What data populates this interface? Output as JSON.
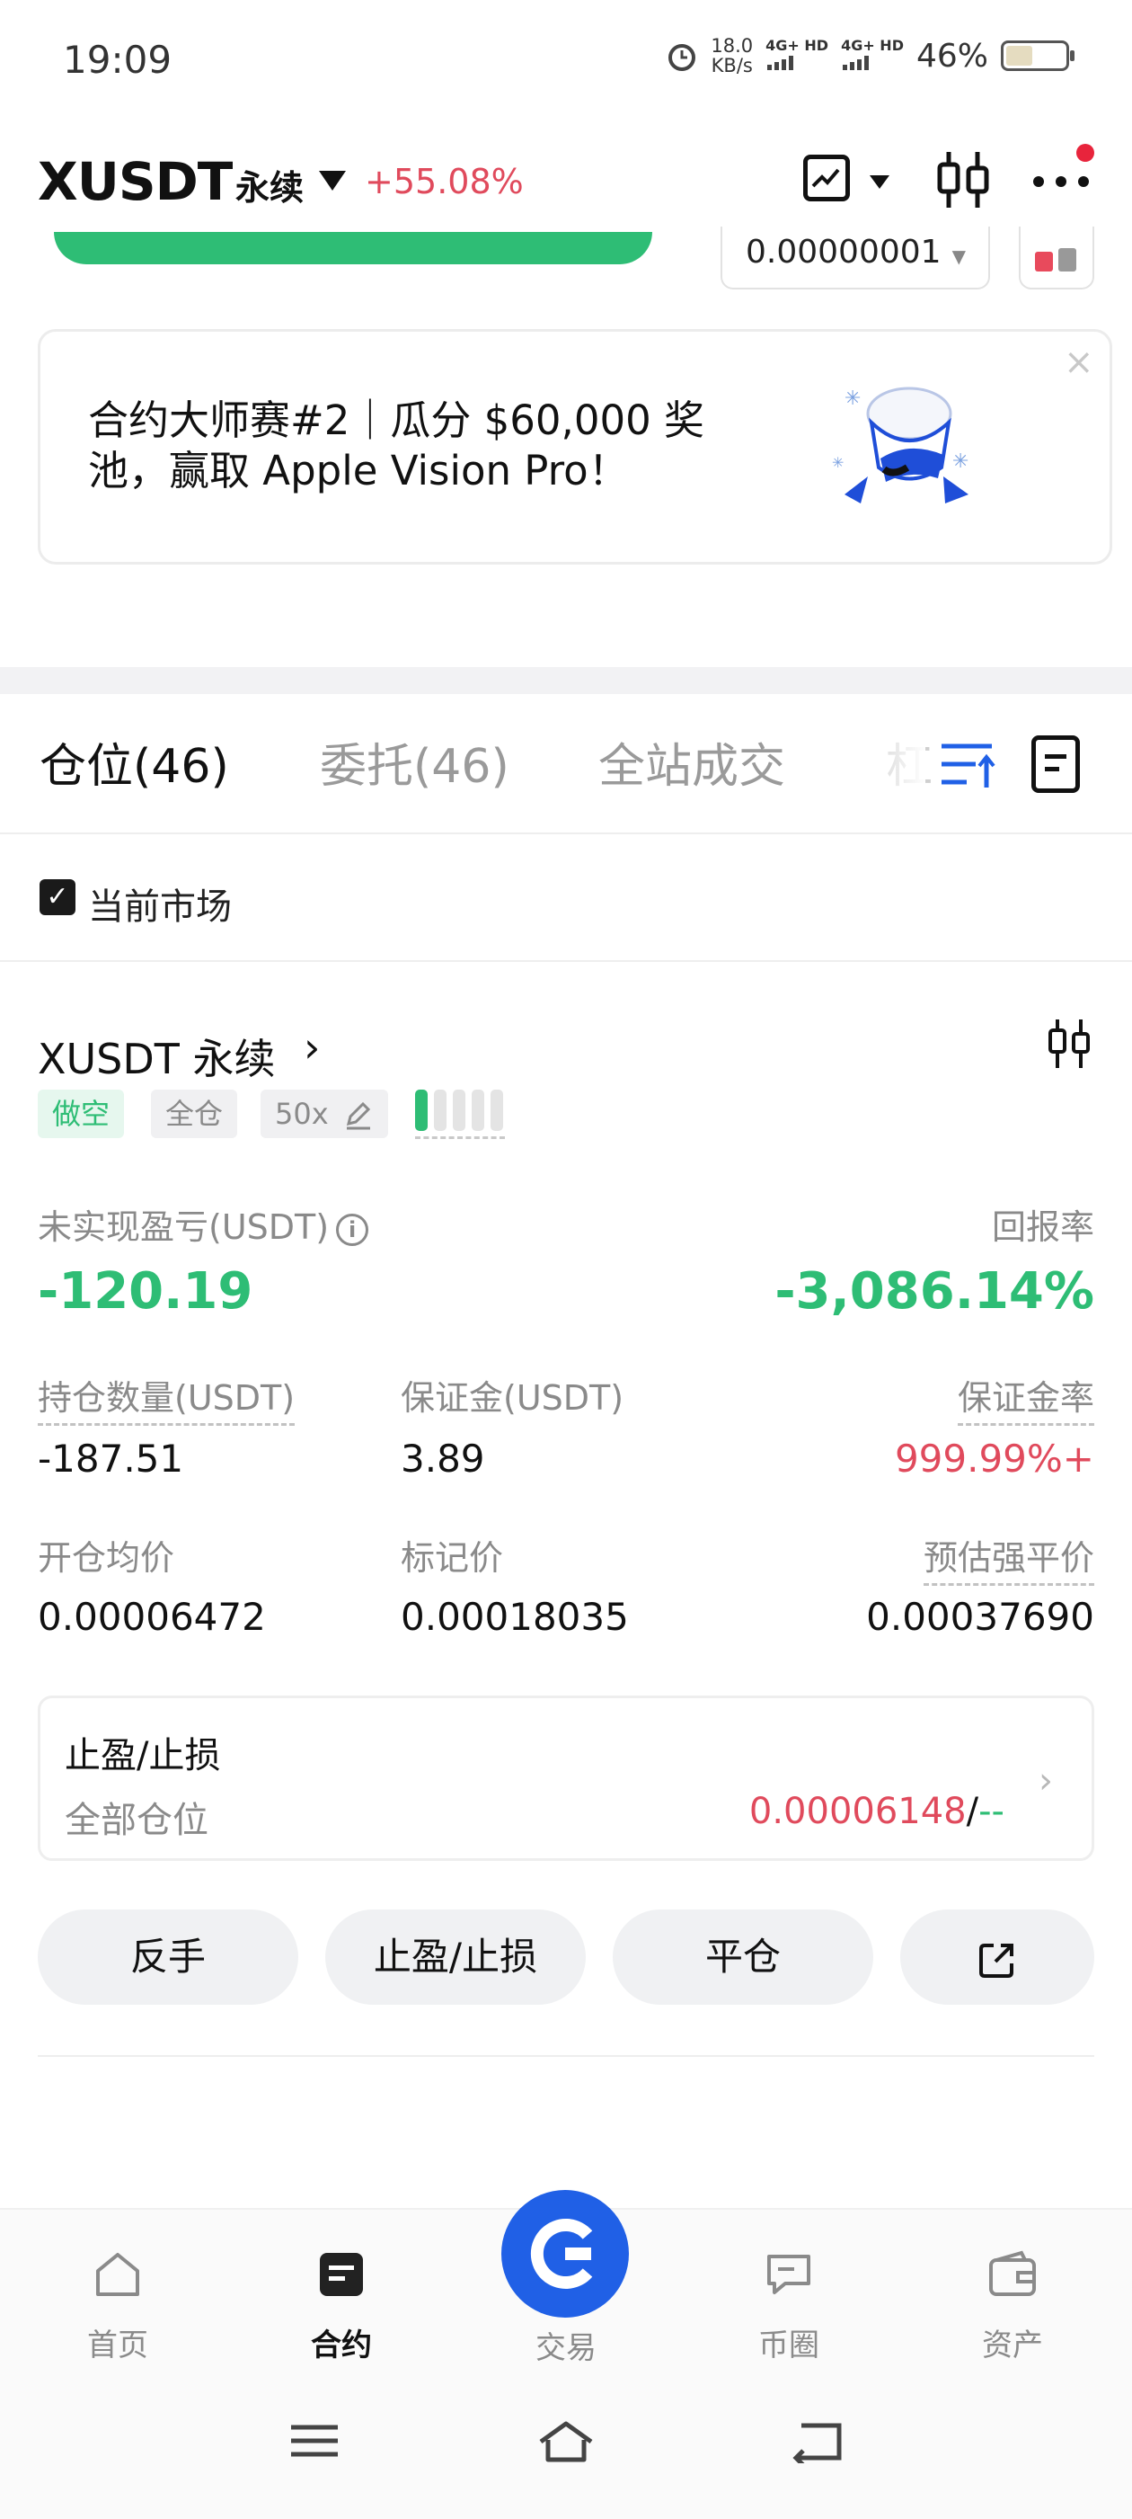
{
  "status_bar": {
    "time": "19:09",
    "net_speed_value": "18.0",
    "net_speed_unit": "KB/s",
    "signal1": "4G+ HD",
    "signal2": "4G+ HD",
    "battery": "46%",
    "battery_level": 0.46
  },
  "header": {
    "pair": "XUSDT",
    "contract_type": "永续",
    "change": "+55.08%",
    "icons": [
      "chart-icon",
      "candlestick-icon",
      "more-icon"
    ]
  },
  "scrolled": {
    "price_input": "0.00000001"
  },
  "banner": {
    "text": "合约大师赛#2｜瓜分 $60,000 奖池，赢取 Apple Vision Pro！",
    "close": "×"
  },
  "tabs": [
    {
      "label": "仓位(46)",
      "active": true
    },
    {
      "label": "委托(46)",
      "active": false
    },
    {
      "label": "全站成交",
      "active": false
    },
    {
      "label": "杠",
      "active": false
    }
  ],
  "filter": {
    "current_market_label": "当前市场",
    "checked": true
  },
  "position": {
    "title": "XUSDT 永续",
    "tags": {
      "side": "做空",
      "margin_mode": "全仓",
      "leverage": "50x"
    },
    "risk_level": 1,
    "risk_bars_total": 5,
    "unrealized_pnl_label": "未实现盈亏(USDT)",
    "unrealized_pnl": "-120.19",
    "roe_label": "回报率",
    "roe": "-3,086.14%",
    "size_label": "持仓数量(USDT)",
    "size": "-187.51",
    "margin_label": "保证金(USDT)",
    "margin": "3.89",
    "margin_ratio_label": "保证金率",
    "margin_ratio": "999.99%+",
    "entry_price_label": "开仓均价",
    "entry_price": "0.00006472",
    "mark_price_label": "标记价",
    "mark_price": "0.00018035",
    "liq_price_label": "预估强平价",
    "liq_price": "0.00037690"
  },
  "tpsl": {
    "title": "止盈/止损",
    "scope": "全部仓位",
    "tp_value": "0.00006148",
    "separator": "/",
    "sl_value": "--"
  },
  "actions": {
    "reverse": "反手",
    "tpsl": "止盈/止损",
    "close": "平仓"
  },
  "bottom_nav": {
    "home": "首页",
    "futures": "合约",
    "trade": "交易",
    "community": "币圈",
    "assets": "资产"
  },
  "colors": {
    "green": "#2ebd75",
    "red": "#e04a5c",
    "brand_blue": "#2060e6"
  }
}
